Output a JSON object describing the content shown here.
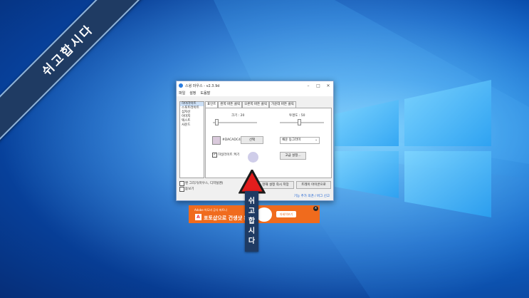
{
  "ribbon": {
    "text": "쉬고합시다"
  },
  "window": {
    "title": "스윙 마우스 - v2.3.9d",
    "menu": [
      "파일",
      "설정",
      "도움말"
    ],
    "sidebar_items": [
      "하이라이트",
      "스포트라이트",
      "십자선",
      "이미지",
      "텍스트",
      "사운드"
    ],
    "tabs": [
      "표인트",
      "왼쪽 버튼 클릭",
      "오른쪽 버튼 클릭",
      "가운데 버튼 클릭"
    ],
    "size_label": "크기 : 20",
    "opacity_label": "투명도 : 50",
    "color_code": "#DACADC4",
    "color_button": "선택",
    "style_select": "채운 동그라미",
    "highlight_checkbox": "하일라이트 켜기",
    "advanced_button": "고급 설정...",
    "pen_checkbox": "펜 그리기(마우스, 디지털펜)",
    "zoom_checkbox": "돋보기",
    "save_button": "현재 설정 즉시 저장",
    "tray_button": "트레이 아이콘으로",
    "footer_link": "기능 추가 의견 / 버그 신고"
  },
  "ad": {
    "brand_line": "Adobe 어도비 공식 파트너",
    "headline": "포토샵으로 건생샷 완성",
    "cta": "자세히보기",
    "close": "x"
  },
  "arrow_label": {
    "text": "쉬고합시다"
  },
  "colors": {
    "ribbon": "#1f3b63",
    "arrow": "#e21d1d",
    "ad": "#f06b1d"
  }
}
